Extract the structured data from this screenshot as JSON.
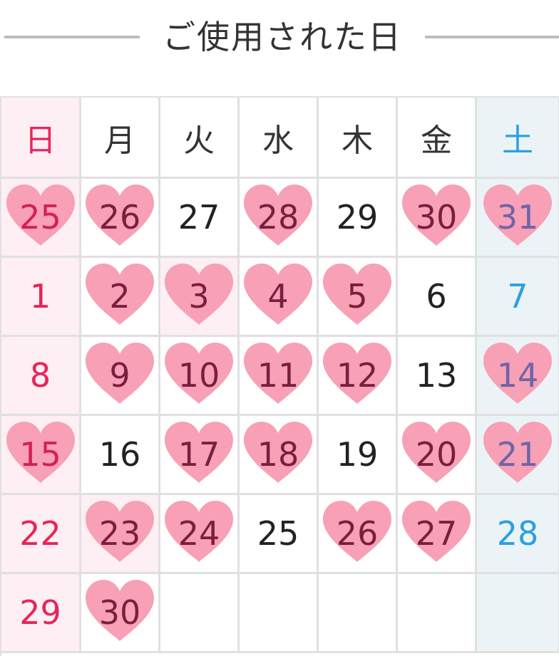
{
  "title": "ご使用された日",
  "colors": {
    "heart": "#f7a0b6",
    "sunday": "#e8245a",
    "saturday": "#2aa1df",
    "sunday_bg": "#fdeff3",
    "saturday_bg": "#ecf3f6",
    "grid_line": "#e0e0e0"
  },
  "weekdays": [
    "日",
    "月",
    "火",
    "水",
    "木",
    "金",
    "土"
  ],
  "weeks": [
    [
      {
        "day": "25",
        "used": true
      },
      {
        "day": "26",
        "used": true
      },
      {
        "day": "27",
        "used": false
      },
      {
        "day": "28",
        "used": true
      },
      {
        "day": "29",
        "used": false
      },
      {
        "day": "30",
        "used": true
      },
      {
        "day": "31",
        "used": true
      }
    ],
    [
      {
        "day": "1",
        "used": false
      },
      {
        "day": "2",
        "used": true
      },
      {
        "day": "3",
        "used": true,
        "today": true
      },
      {
        "day": "4",
        "used": true
      },
      {
        "day": "5",
        "used": true
      },
      {
        "day": "6",
        "used": false
      },
      {
        "day": "7",
        "used": false
      }
    ],
    [
      {
        "day": "8",
        "used": false
      },
      {
        "day": "9",
        "used": true
      },
      {
        "day": "10",
        "used": true
      },
      {
        "day": "11",
        "used": true
      },
      {
        "day": "12",
        "used": true
      },
      {
        "day": "13",
        "used": false
      },
      {
        "day": "14",
        "used": true
      }
    ],
    [
      {
        "day": "15",
        "used": true
      },
      {
        "day": "16",
        "used": false
      },
      {
        "day": "17",
        "used": true
      },
      {
        "day": "18",
        "used": true
      },
      {
        "day": "19",
        "used": false
      },
      {
        "day": "20",
        "used": true
      },
      {
        "day": "21",
        "used": true
      }
    ],
    [
      {
        "day": "22",
        "used": false
      },
      {
        "day": "23",
        "used": true,
        "today": true
      },
      {
        "day": "24",
        "used": true
      },
      {
        "day": "25",
        "used": false
      },
      {
        "day": "26",
        "used": true
      },
      {
        "day": "27",
        "used": true
      },
      {
        "day": "28",
        "used": false
      }
    ],
    [
      {
        "day": "29",
        "used": false
      },
      {
        "day": "30",
        "used": true
      },
      {
        "day": "",
        "used": false
      },
      {
        "day": "",
        "used": false
      },
      {
        "day": "",
        "used": false
      },
      {
        "day": "",
        "used": false
      },
      {
        "day": "",
        "used": false
      }
    ]
  ]
}
